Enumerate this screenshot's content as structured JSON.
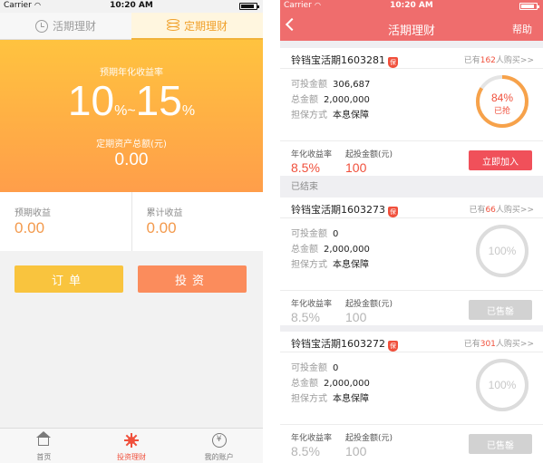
{
  "status_bar": {
    "carrier": "Carrier",
    "time": "10:20 AM"
  },
  "left": {
    "tabs": [
      {
        "label": "活期理财",
        "icon": "clock-icon"
      },
      {
        "label": "定期理财",
        "icon": "coins-icon"
      }
    ],
    "hero": {
      "rate_label": "预期年化收益率",
      "rate_low": "10",
      "rate_unit": "%",
      "rate_sep": "~",
      "rate_high": "15",
      "rate_unit2": "%",
      "total_label": "定期资产总额(元)",
      "total_value": "0.00"
    },
    "earnings": [
      {
        "label": "预期收益",
        "value": "0.00"
      },
      {
        "label": "累计收益",
        "value": "0.00"
      }
    ],
    "buttons": {
      "order": "订单",
      "invest": "投资"
    },
    "tabbar": [
      {
        "label": "首页",
        "icon": "home-icon"
      },
      {
        "label": "投资理财",
        "icon": "sun-icon"
      },
      {
        "label": "我的账户",
        "icon": "yen-icon"
      }
    ]
  },
  "right": {
    "nav": {
      "title": "活期理财",
      "help": "帮助"
    },
    "section_label": "已结束",
    "field_labels": {
      "available": "可投金额",
      "total": "总金额",
      "guarantee": "担保方式",
      "rate": "年化收益率",
      "min": "起投金额(元)"
    },
    "cards": [
      {
        "name": "铃铛宝活期1603281",
        "badge": "保",
        "buyers_prefix": "已有",
        "buyers_count": "162",
        "buyers_suffix": "人购买>>",
        "available": "306,687",
        "total": "2,000,000",
        "guarantee": "本息保障",
        "ring_pct_text": "84%",
        "ring_sub": "已抢",
        "ring_fraction": 0.84,
        "rate": "8.5%",
        "min": "100",
        "action": "立即加入"
      },
      {
        "name": "铃铛宝活期1603273",
        "badge": "保",
        "buyers_prefix": "已有",
        "buyers_count": "66",
        "buyers_suffix": "人购买>>",
        "available": "0",
        "total": "2,000,000",
        "guarantee": "本息保障",
        "ring_pct_text": "100%",
        "ring_fraction": 1.0,
        "rate": "8.5%",
        "min": "100",
        "action": "已售罄"
      },
      {
        "name": "铃铛宝活期1603272",
        "badge": "保",
        "buyers_prefix": "已有",
        "buyers_count": "301",
        "buyers_suffix": "人购买>>",
        "available": "0",
        "total": "2,000,000",
        "guarantee": "本息保障",
        "ring_pct_text": "100%",
        "ring_fraction": 1.0,
        "rate": "8.5%",
        "min": "100",
        "action": "已售罄"
      }
    ]
  },
  "colors": {
    "accent_red": "#ef6d6d",
    "hero_top": "#ffc33f",
    "hero_bottom": "#ff9e4a",
    "ring_active": "#f7a24a",
    "ring_done": "#dcdcdc"
  }
}
